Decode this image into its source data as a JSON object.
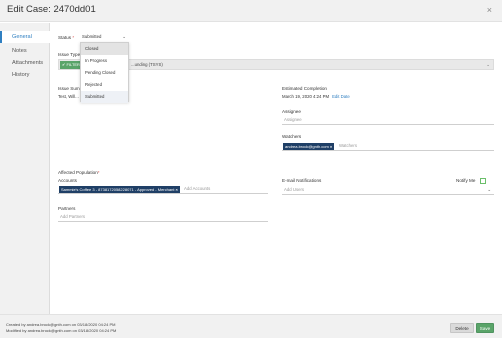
{
  "header": {
    "title": "Edit Case: 2470dd01",
    "close_symbol": "×"
  },
  "sidebar": {
    "items": [
      {
        "label": "General",
        "active": true
      },
      {
        "label": "Notes"
      },
      {
        "label": "Attachments"
      },
      {
        "label": "History"
      }
    ]
  },
  "form": {
    "status": {
      "label": "Status",
      "required_mark": "*",
      "value": "Submitted",
      "caret": "⌄",
      "options": [
        "Closed",
        "In Progress",
        "Pending Closed",
        "Rejected",
        "Submitted"
      ]
    },
    "issue_type": {
      "label": "Issue Type",
      "tag": "✔ FILTER",
      "value": "...unding (TSYS)",
      "caret": "⌄"
    },
    "issue_summary": {
      "label": "Issue Sum",
      "value": "Test, Will..."
    },
    "estimated_completion": {
      "label": "Estimated Completion",
      "value": "March 19, 2020 4:24 PM",
      "link": "Edit Date"
    },
    "assignee": {
      "label": "Assignee",
      "placeholder": "Assignee"
    },
    "watchers": {
      "label": "Watchers",
      "chip": "andrea.brock@gnth.com",
      "chip_close": "×",
      "placeholder": "Watchers"
    },
    "affected_population": {
      "label": "Affected Population",
      "required_mark": "*"
    },
    "accounts": {
      "label": "Accounts",
      "chip": "Sammie's Coffee 3 - 8738172058228071 - Approved - Merchant",
      "chip_close": "×",
      "placeholder": "Add Accounts"
    },
    "partners": {
      "label": "Partners",
      "placeholder": "Add Partners"
    },
    "email_notifications": {
      "label": "E-mail Notifications",
      "placeholder": "Add Users",
      "caret": "⌄"
    },
    "notify_me": {
      "label": "Notify Me"
    }
  },
  "footer": {
    "created": "Created by andrea.brock@gnth.com on 03/18/2020 04:24 PM",
    "modified": "Modified by andrea.brock@gnth.com on 03/18/2020 04:24 PM",
    "delete_label": "Delete",
    "save_label": "Save"
  },
  "colors": {
    "accent": "#2f7fc1",
    "save": "#5aa469",
    "chip": "#1f3f66"
  }
}
